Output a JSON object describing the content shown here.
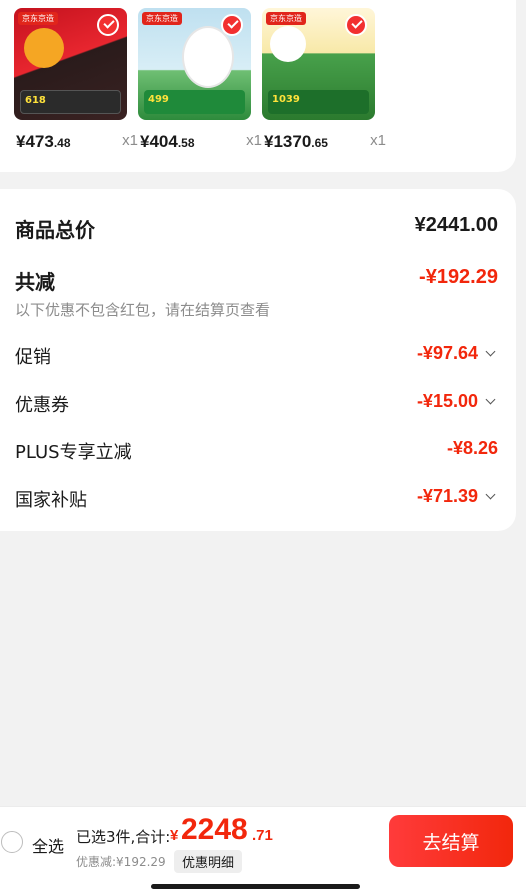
{
  "products": [
    {
      "tag": "京东京造",
      "art_text": "618",
      "price_int": "¥473",
      "price_cents": ".48",
      "qty": "x1"
    },
    {
      "tag": "京东京造",
      "art_text": "499",
      "price_int": "¥404",
      "price_cents": ".58",
      "qty": "x1"
    },
    {
      "tag": "京东京造",
      "art_text": "1039",
      "price_int": "¥1370",
      "price_cents": ".65",
      "qty": "x1"
    }
  ],
  "summary": {
    "total_label": "商品总价",
    "total_value": "¥2441.00",
    "reduce_label": "共减",
    "reduce_value": "-¥192.29",
    "reduce_note": "以下优惠不包含红包，请在结算页查看",
    "promo_label": "促销",
    "promo_value": "-¥97.64",
    "coupon_label": "优惠券",
    "coupon_value": "-¥15.00",
    "plus_label": "PLUS专享立减",
    "plus_value": "-¥8.26",
    "subsidy_label": "国家补贴",
    "subsidy_value": "-¥71.39"
  },
  "footer": {
    "select_all": "全选",
    "selected_text": "已选3件,合计:",
    "total_yen": "¥",
    "total_int": "2248",
    "total_dec": ".71",
    "discount_text": "优惠减:¥192.29",
    "discount_detail": "优惠明细",
    "checkout": "去结算"
  },
  "colors": {
    "accent_red": "#f2270c",
    "page_bg": "#f2f2f2"
  }
}
